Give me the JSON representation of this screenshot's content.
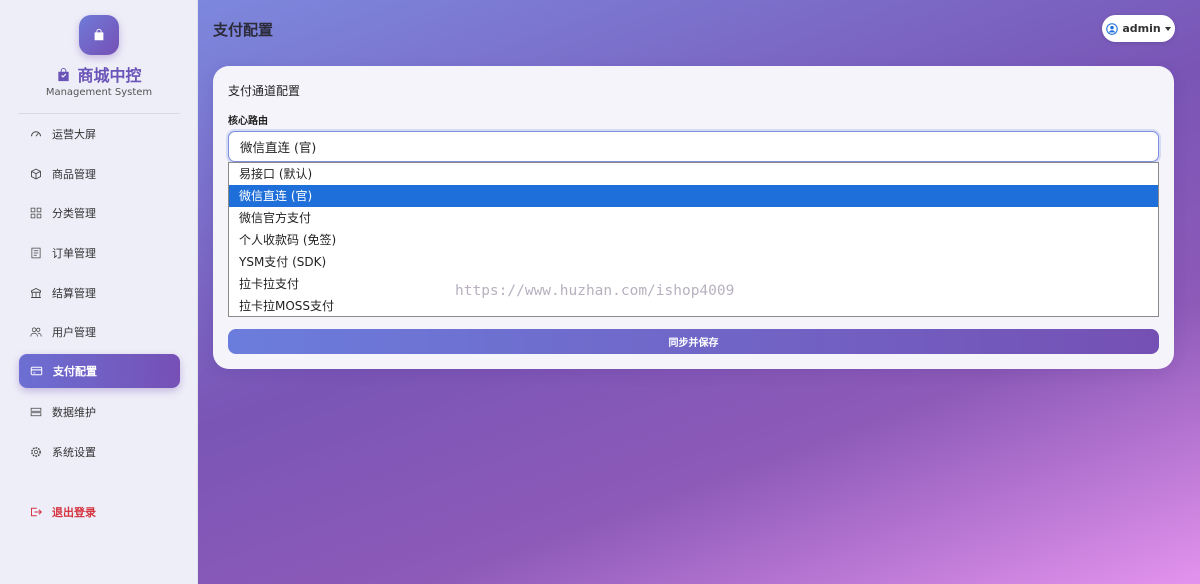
{
  "brand": {
    "name": "商城中控",
    "subtitle": "Management System"
  },
  "sidebar": {
    "items": [
      {
        "label": "运营大屏",
        "icon": "speedometer-icon"
      },
      {
        "label": "商品管理",
        "icon": "box-icon"
      },
      {
        "label": "分类管理",
        "icon": "grid-icon"
      },
      {
        "label": "订单管理",
        "icon": "receipt-icon"
      },
      {
        "label": "结算管理",
        "icon": "cash-icon"
      },
      {
        "label": "用户管理",
        "icon": "people-icon"
      },
      {
        "label": "支付配置",
        "icon": "credit-card-icon",
        "active": true
      },
      {
        "label": "数据维护",
        "icon": "hdd-icon"
      },
      {
        "label": "系统设置",
        "icon": "gear-icon"
      }
    ],
    "logout_label": "退出登录"
  },
  "header": {
    "title": "支付配置",
    "user": "admin"
  },
  "card": {
    "title": "支付通道配置",
    "field_label": "核心路由",
    "selected_value": "微信直连 (官)",
    "options": [
      "易接口 (默认)",
      "微信直连 (官)",
      "微信官方支付",
      "个人收款码 (免签)",
      "YSM支付 (SDK)",
      "拉卡拉支付",
      "拉卡拉MOSS支付"
    ],
    "selected_index": 1,
    "save_label": "同步并保存"
  },
  "watermark": "https://www.huzhan.com/ishop4009",
  "colors": {
    "accent": "#7650b5",
    "selected_option": "#1e6fd9",
    "logout": "#d4333f"
  }
}
